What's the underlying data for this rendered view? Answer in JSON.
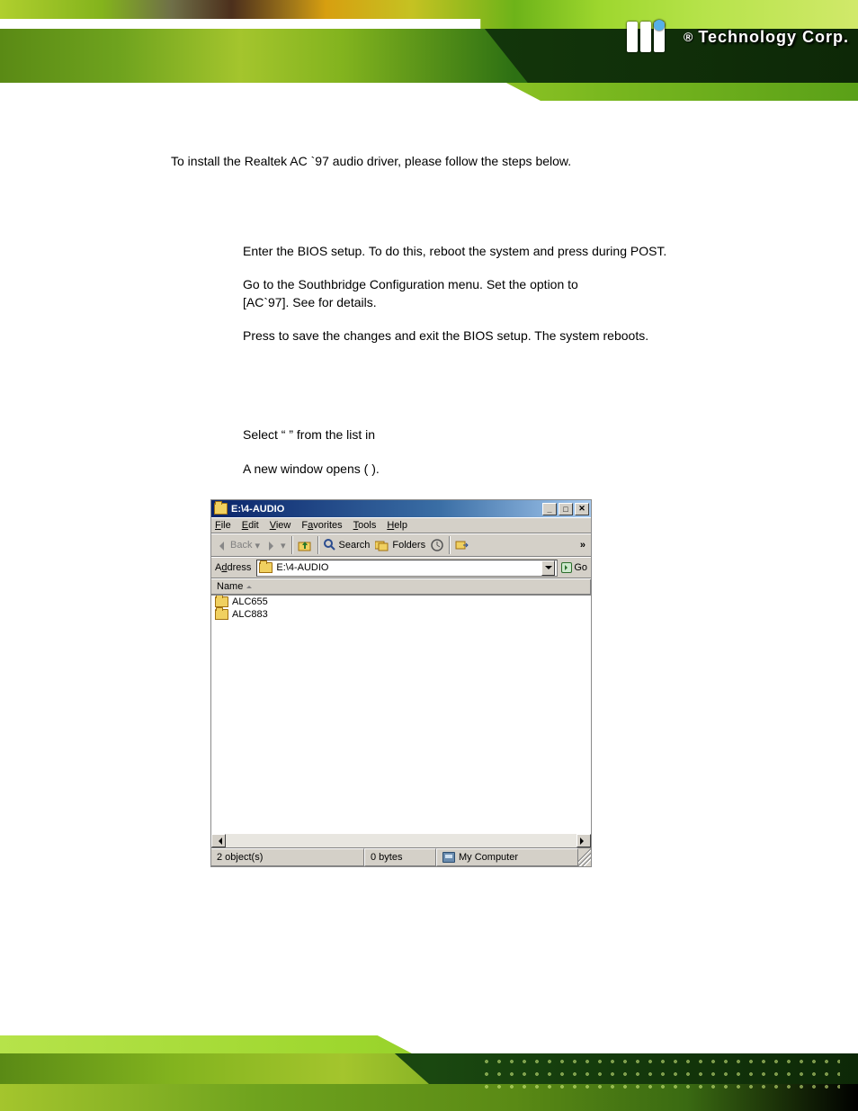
{
  "header": {
    "brand_reg": "®",
    "brand_text": "Technology Corp."
  },
  "content": {
    "intro": "To install the Realtek AC `97 audio driver, please follow the steps below.",
    "step1_a": "Enter the BIOS setup. To do this, reboot the system and press ",
    "step1_b": " during POST.",
    "step2_a": "Go to the Southbridge Configuration menu. Set the ",
    "step2_b": " option to",
    "step2_c": "[AC`97]. See ",
    "step2_d": " for details.",
    "step3_a": "Press ",
    "step3_b": " to save the changes and exit the BIOS setup. The system reboots.",
    "sub_step1_a": "Select “",
    "sub_step1_b": "” from the list in",
    "sub_step2_a": "A new window opens (",
    "sub_step2_b": ")."
  },
  "explorer": {
    "title": "E:\\4-AUDIO",
    "menu": {
      "file": "File",
      "edit": "Edit",
      "view": "View",
      "favorites": "Favorites",
      "tools": "Tools",
      "help": "Help"
    },
    "toolbar": {
      "back": "Back",
      "search": "Search",
      "folders": "Folders",
      "more": "»"
    },
    "addr_label": "Address",
    "addr_value": "E:\\4-AUDIO",
    "go": "Go",
    "col_name": "Name",
    "files": [
      {
        "name": "ALC655"
      },
      {
        "name": "ALC883"
      }
    ],
    "status_objects": "2 object(s)",
    "status_bytes": "0 bytes",
    "status_loc": "My Computer"
  }
}
